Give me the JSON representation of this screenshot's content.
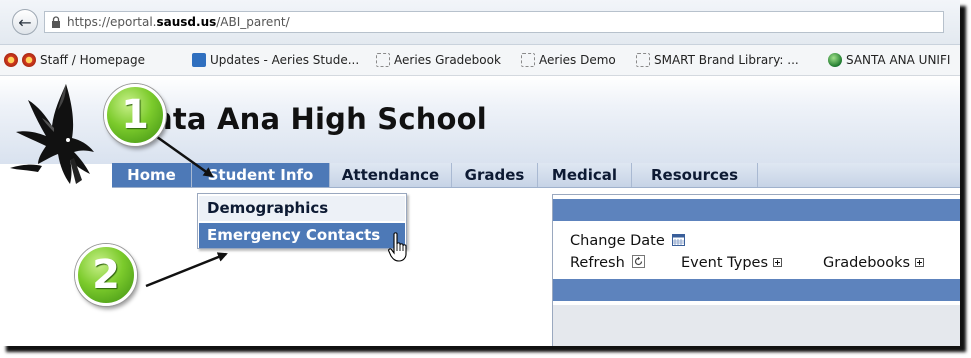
{
  "browser": {
    "url_prefix": "https://eportal.",
    "url_domain": "sausd.us",
    "url_path": "/ABI_parent/",
    "bookmarks": [
      {
        "label": "Staff / Homepage",
        "icon": "seal-icon"
      },
      {
        "label": "Updates - Aeries Stude...",
        "icon": "aeries-icon"
      },
      {
        "label": "Aeries Gradebook",
        "icon": "blank-page-icon"
      },
      {
        "label": "Aeries Demo",
        "icon": "blank-page-icon"
      },
      {
        "label": "SMART Brand Library: ...",
        "icon": "blank-page-icon"
      },
      {
        "label": "SANTA ANA UNIFI",
        "icon": "globe-icon"
      }
    ]
  },
  "page": {
    "school_name": "nta Ana High School"
  },
  "nav": {
    "items": [
      {
        "label": "Home",
        "state": "active"
      },
      {
        "label": "Student Info",
        "state": "hover"
      },
      {
        "label": "Attendance",
        "state": "normal"
      },
      {
        "label": "Grades",
        "state": "normal"
      },
      {
        "label": "Medical",
        "state": "normal"
      },
      {
        "label": "Resources",
        "state": "normal"
      }
    ]
  },
  "dropdown": {
    "items": [
      {
        "label": "Demographics",
        "highlighted": false
      },
      {
        "label": "Emergency Contacts",
        "highlighted": true
      }
    ]
  },
  "panel": {
    "change_date": "Change Date",
    "refresh": "Refresh",
    "event_types": "Event Types",
    "gradebooks": "Gradebooks"
  },
  "callouts": {
    "step1": "1",
    "step2": "2"
  },
  "colors": {
    "nav_active": "#4d79b7",
    "panel_bar": "#5d83bd",
    "badge_green": "#7ccb2c"
  }
}
